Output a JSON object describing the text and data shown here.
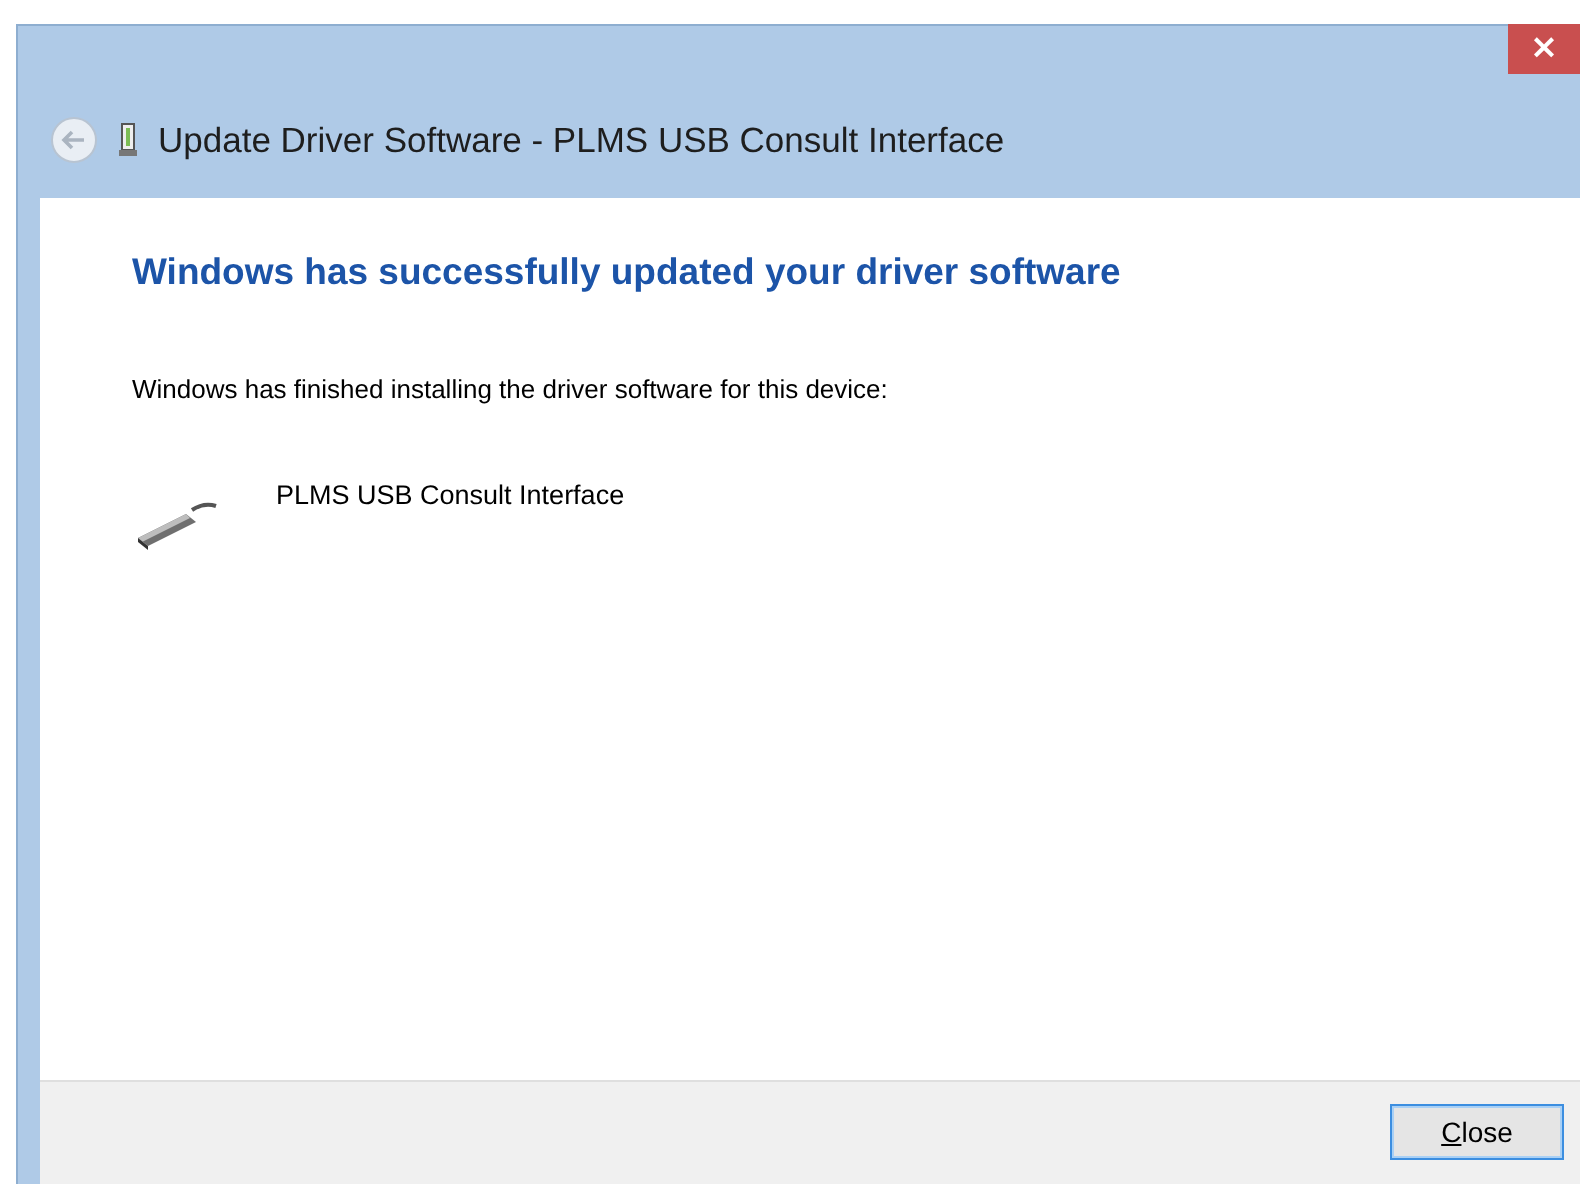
{
  "window": {
    "title": "Update Driver Software - PLMS USB Consult Interface",
    "close_glyph": "×"
  },
  "heading": "Windows has successfully updated your driver software",
  "message": "Windows has finished installing the driver software for this device:",
  "device": {
    "name": "PLMS USB Consult Interface"
  },
  "buttons": [
    {
      "label": "Close",
      "kind": "default"
    }
  ]
}
